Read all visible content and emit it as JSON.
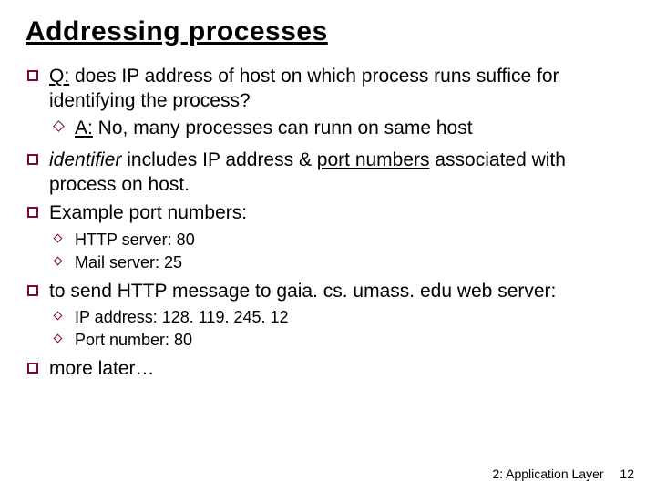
{
  "title": "Addressing processes",
  "items": {
    "q": {
      "prefix": "Q:",
      "text": " does  IP address of host on which process runs suffice for identifying the process?",
      "answer_prefix": "A:",
      "answer_text": " No, many processes can runn on same host"
    },
    "identifier": {
      "word_identifier": "identifier",
      "rest1": " includes IP address & ",
      "port": "port numbers",
      "rest2": " associated with process on host."
    },
    "example_label": "Example port numbers:",
    "examples": {
      "http": "HTTP server: 80",
      "mail": "Mail server: 25"
    },
    "send_text": "to send HTTP message to gaia. cs. umass. edu web server:",
    "send": {
      "ip": "IP address: 128. 119. 245. 12",
      "port": "Port number: 80"
    },
    "more": "more later…"
  },
  "footer": {
    "label": "2: Application Layer",
    "page": "12"
  }
}
